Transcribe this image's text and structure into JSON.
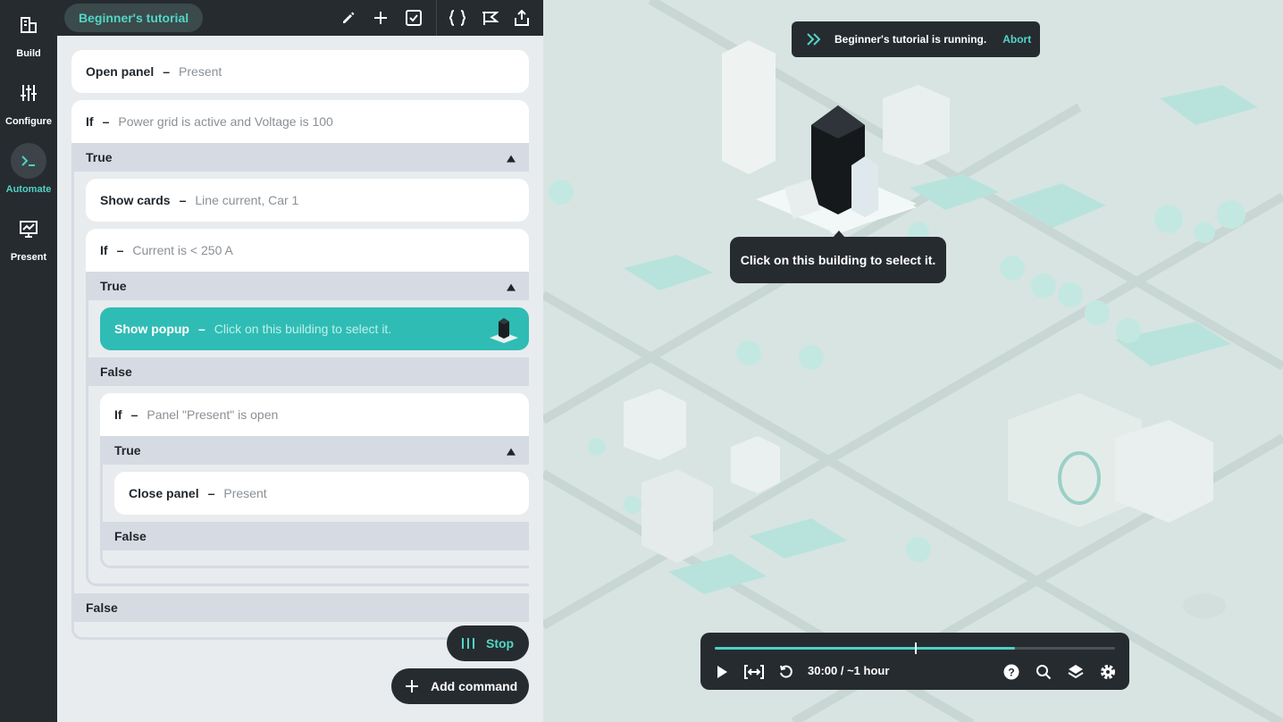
{
  "nav": {
    "items": [
      {
        "label": "Build",
        "icon": "build-icon"
      },
      {
        "label": "Configure",
        "icon": "sliders-icon"
      },
      {
        "label": "Automate",
        "icon": "terminal-icon"
      },
      {
        "label": "Present",
        "icon": "presentation-icon"
      }
    ],
    "active": "Automate"
  },
  "toolbar": {
    "tutorial_pill": "Beginner's tutorial",
    "icons": [
      "pencil-icon",
      "plus-icon",
      "checkbox-icon",
      "braces-icon",
      "flag-icon",
      "share-icon"
    ]
  },
  "script": {
    "open_panel": {
      "keyword": "Open panel",
      "arg": "Present"
    },
    "if1": {
      "keyword": "If",
      "arg": "Power grid is active and Voltage is 100"
    },
    "true1": "True",
    "show_cards": {
      "keyword": "Show cards",
      "arg": "Line current, Car 1"
    },
    "if2": {
      "keyword": "If",
      "arg": "Current is < 250 A"
    },
    "true2": "True",
    "show_popup": {
      "keyword": "Show popup",
      "arg": "Click on this building to select it."
    },
    "false2": "False",
    "if3": {
      "keyword": "If",
      "arg": "Panel \"Present\" is open"
    },
    "true3": "True",
    "close_panel": {
      "keyword": "Close panel",
      "arg": "Present"
    },
    "false3": "False",
    "false1": "False",
    "dash": "–"
  },
  "actions": {
    "stop_label": "Stop",
    "add_command_label": "Add command"
  },
  "banner": {
    "text": "Beginner's tutorial is running.",
    "abort_label": "Abort"
  },
  "tooltip": {
    "text": "Click on this building to select it."
  },
  "player": {
    "time": "30:00 / ~1 hour",
    "progress": 0.75,
    "marker": 0.5
  },
  "colors": {
    "accent": "#4fd1c1",
    "dark": "#262b30",
    "active_card": "#2fbcb5"
  }
}
